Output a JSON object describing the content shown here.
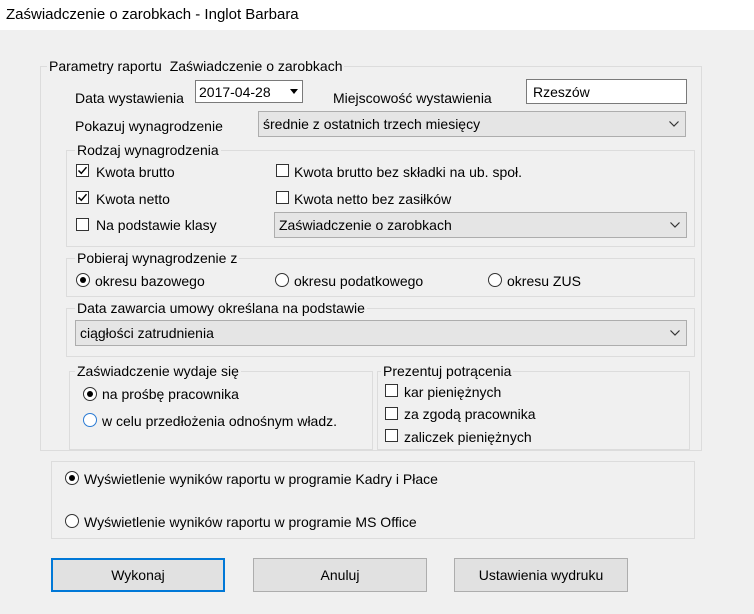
{
  "window": {
    "title": "Zaświadczenie o zarobkach - Inglot Barbara"
  },
  "params": {
    "legend_label": "Parametry raportu",
    "legend_value": "Zaświadczenie o zarobkach",
    "issue_date_label": "Data wystawienia",
    "issue_date_value": "2017-04-28",
    "place_label": "Miejscowość wystawienia",
    "place_value": "Rzeszów",
    "show_salary_label": "Pokazuj wynagrodzenie",
    "show_salary_value": "średnie z ostatnich trzech miesięcy"
  },
  "salary_type": {
    "legend": "Rodzaj wynagrodzenia",
    "gross": {
      "label": "Kwota brutto",
      "checked": true
    },
    "net": {
      "label": "Kwota netto",
      "checked": true
    },
    "by_class": {
      "label": "Na podstawie klasy",
      "checked": false
    },
    "gross_no_sick": {
      "label": "Kwota brutto bez składki na ub. społ.",
      "checked": false
    },
    "net_no_benefits": {
      "label": "Kwota netto bez zasiłków",
      "checked": false
    },
    "class_combo_value": "Zaświadczenie o zarobkach"
  },
  "salary_source": {
    "legend": "Pobieraj wynagrodzenie z",
    "options": [
      "okresu bazowego",
      "okresu podatkowego",
      "okresu ZUS"
    ],
    "selected": "okresu bazowego"
  },
  "contract_date": {
    "legend": "Data zawarcia umowy określana na podstawie",
    "value": "ciągłości zatrudnienia"
  },
  "issued_for": {
    "legend": "Zaświadczenie wydaje się",
    "options": [
      "na prośbę pracownika",
      "w celu przedłożenia odnośnym władz."
    ],
    "selected": "na prośbę pracownika"
  },
  "deductions": {
    "legend": "Prezentuj potrącenia",
    "items": [
      {
        "label": "kar pieniężnych",
        "checked": false
      },
      {
        "label": "za zgodą pracownika",
        "checked": false
      },
      {
        "label": "zaliczek pieniężnych",
        "checked": false
      }
    ]
  },
  "output": {
    "options": [
      "Wyświetlenie wyników raportu w programie Kadry i Płace",
      "Wyświetlenie wyników raportu w programie MS Office"
    ],
    "selected": "Wyświetlenie wyników raportu w programie Kadry i Płace"
  },
  "buttons": {
    "execute": "Wykonaj",
    "cancel": "Anuluj",
    "print_settings": "Ustawienia wydruku"
  },
  "colors": {
    "focus_blue": "#0078d7",
    "accent_radio": "#2b7bd4"
  }
}
